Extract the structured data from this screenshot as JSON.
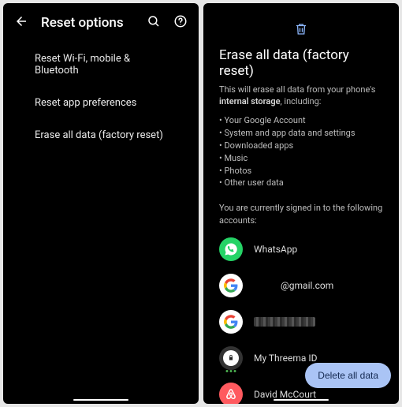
{
  "left": {
    "title": "Reset options",
    "options": [
      "Reset Wi-Fi, mobile & Bluetooth",
      "Reset app preferences",
      "Erase all data (factory reset)"
    ]
  },
  "right": {
    "title": "Erase all data (factory reset)",
    "desc_pre": "This will erase all data from your phone's ",
    "desc_em": "internal storage",
    "desc_post": ", including:",
    "bullets": [
      "Your Google Account",
      "System and app data and settings",
      "Downloaded apps",
      "Music",
      "Photos",
      "Other user data"
    ],
    "signed": "You are currently signed in to the following accounts:",
    "accounts": {
      "whatsapp": "WhatsApp",
      "gmail": "@gmail.com",
      "threema": "My Threema ID",
      "airbnb": "David McCourt"
    },
    "delete_label": "Delete all data"
  }
}
